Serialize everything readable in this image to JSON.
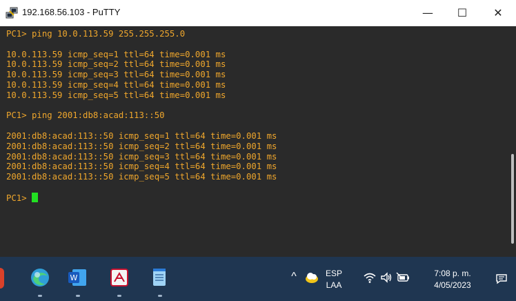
{
  "window": {
    "title": "192.168.56.103 - PuTTY",
    "minimize_glyph": "—",
    "maximize_glyph": "☐",
    "close_glyph": "✕",
    "icon": "putty-icon"
  },
  "terminal": {
    "colors": {
      "background": "#2a2a2a",
      "text": "#f0a72c",
      "cursor": "#22e022"
    },
    "lines": [
      "PC1> ping 10.0.113.59 255.255.255.0",
      "",
      "10.0.113.59 icmp_seq=1 ttl=64 time=0.001 ms",
      "10.0.113.59 icmp_seq=2 ttl=64 time=0.001 ms",
      "10.0.113.59 icmp_seq=3 ttl=64 time=0.001 ms",
      "10.0.113.59 icmp_seq=4 ttl=64 time=0.001 ms",
      "10.0.113.59 icmp_seq=5 ttl=64 time=0.001 ms",
      "",
      "PC1> ping 2001:db8:acad:113::50",
      "",
      "2001:db8:acad:113::50 icmp_seq=1 ttl=64 time=0.001 ms",
      "2001:db8:acad:113::50 icmp_seq=2 ttl=64 time=0.001 ms",
      "2001:db8:acad:113::50 icmp_seq=3 ttl=64 time=0.001 ms",
      "2001:db8:acad:113::50 icmp_seq=4 ttl=64 time=0.001 ms",
      "2001:db8:acad:113::50 icmp_seq=5 ttl=64 time=0.001 ms",
      "",
      "PC1> "
    ]
  },
  "taskbar": {
    "apps": [
      "edge-icon",
      "word-icon",
      "acrobat-icon",
      "notepad-icon"
    ],
    "tray": {
      "chevron_glyph": "^",
      "language_top": "ESP",
      "language_bottom": "LAA",
      "time": "7:08 p. m.",
      "date": "4/05/2023",
      "icons": [
        "cloud-icon",
        "wifi-icon",
        "speaker-icon",
        "battery-icon",
        "notification-icon"
      ]
    }
  }
}
